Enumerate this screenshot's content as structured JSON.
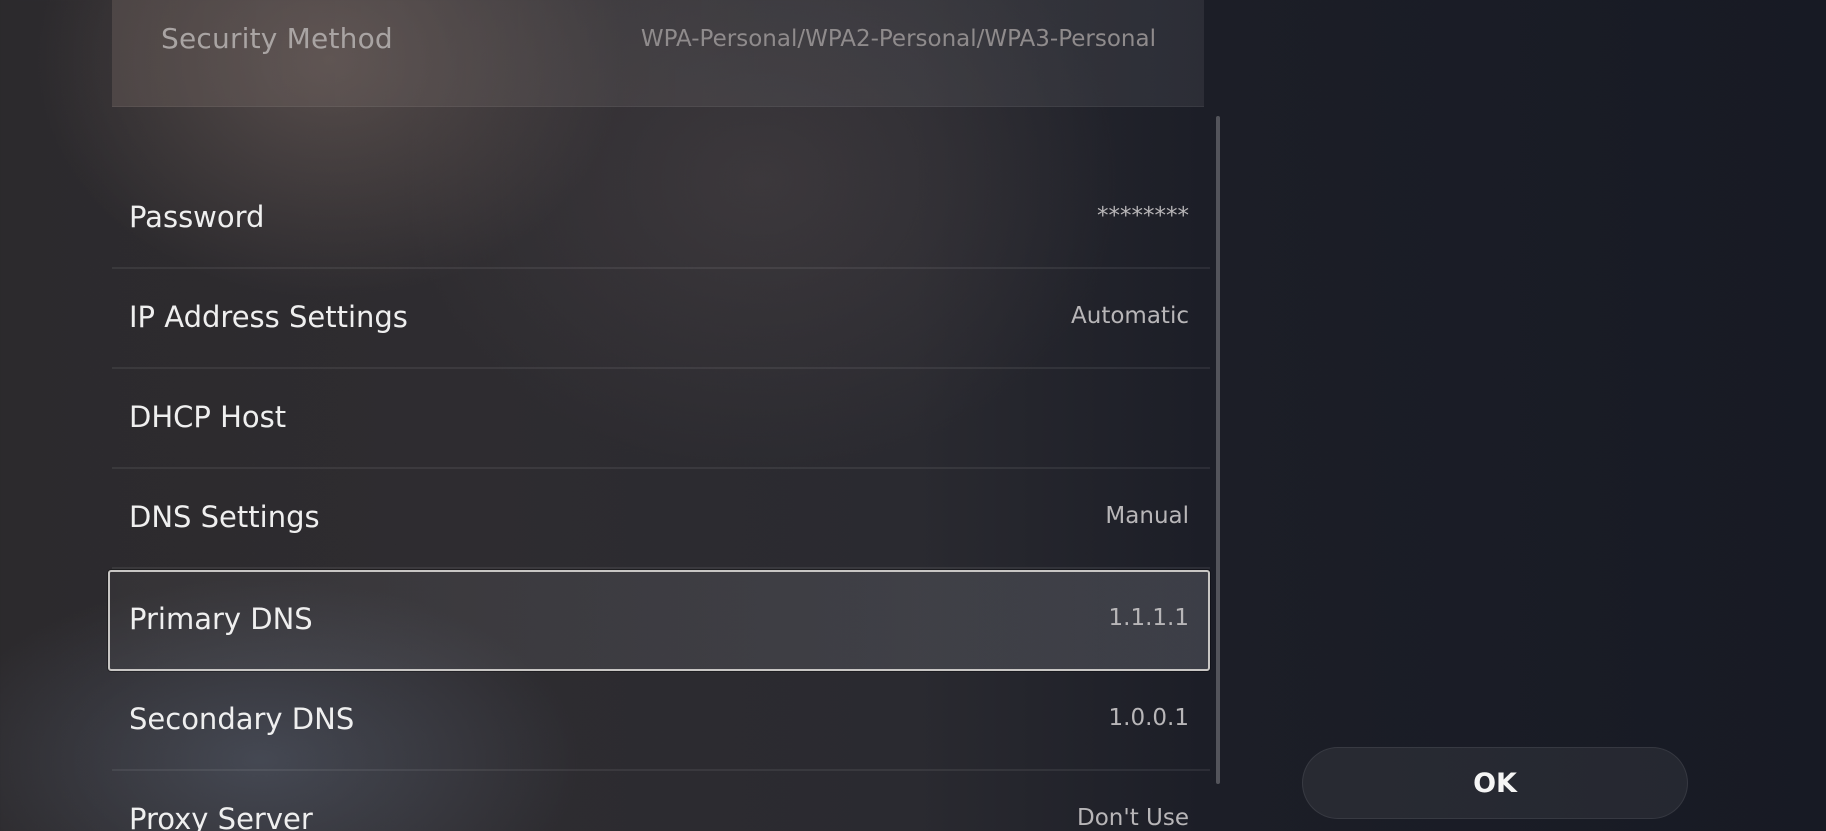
{
  "security": {
    "label": "Security Method",
    "value": "WPA-Personal/WPA2-Personal/WPA3-Personal"
  },
  "settings": [
    {
      "label": "Password",
      "value": "********"
    },
    {
      "label": "IP Address Settings",
      "value": "Automatic"
    },
    {
      "label": "DHCP Host",
      "value": ""
    },
    {
      "label": "DNS Settings",
      "value": "Manual"
    },
    {
      "label": "Primary DNS",
      "value": "1.1.1.1",
      "selected": true
    },
    {
      "label": "Secondary DNS",
      "value": "1.0.0.1"
    },
    {
      "label": "Proxy Server",
      "value": "Don't Use"
    }
  ],
  "actions": {
    "ok_label": "OK"
  },
  "colors": {
    "background": "#1c1e27",
    "selection_border": "#c8c6c4",
    "text_primary": "#efefef",
    "text_secondary": "#b8b6b8"
  }
}
